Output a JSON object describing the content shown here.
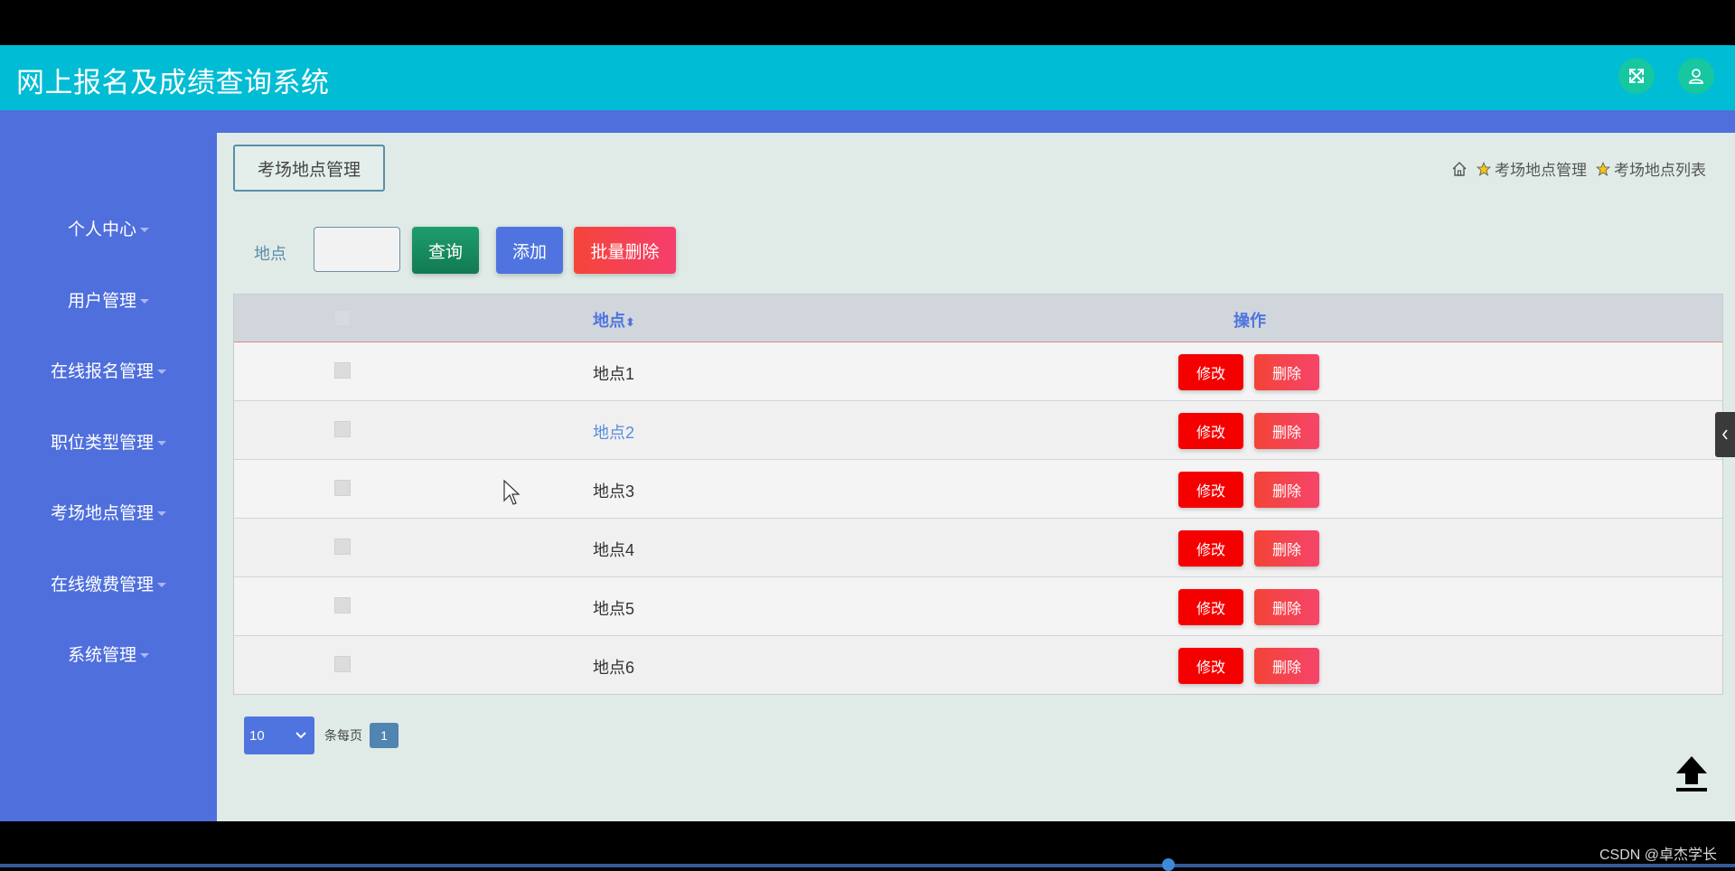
{
  "app": {
    "title": "网上报名及成绩查询系统"
  },
  "header": {
    "icons": [
      "fullscreen-icon",
      "user-icon"
    ]
  },
  "sidebar": {
    "items": [
      {
        "label": "个人中心"
      },
      {
        "label": "用户管理"
      },
      {
        "label": "在线报名管理"
      },
      {
        "label": "职位类型管理"
      },
      {
        "label": "考场地点管理"
      },
      {
        "label": "在线缴费管理"
      },
      {
        "label": "系统管理"
      }
    ]
  },
  "page": {
    "title": "考场地点管理"
  },
  "breadcrumb": {
    "item1": "考场地点管理",
    "item2": "考场地点列表"
  },
  "search": {
    "label": "地点",
    "value": "",
    "query_label": "查询",
    "add_label": "添加",
    "bulk_delete_label": "批量删除"
  },
  "table": {
    "headers": {
      "location": "地点",
      "sort_icon": "⬍",
      "operations": "操作"
    },
    "rows": [
      {
        "location": "地点1"
      },
      {
        "location": "地点2"
      },
      {
        "location": "地点3"
      },
      {
        "location": "地点4"
      },
      {
        "location": "地点5"
      },
      {
        "location": "地点6"
      }
    ],
    "edit_label": "修改",
    "delete_label": "删除"
  },
  "pagination": {
    "page_size": "10",
    "per_page_text": "条每页",
    "current_page": "1"
  },
  "watermark": "CSDN @卓杰学长",
  "colors": {
    "header": "#00bcd4",
    "sidebar": "#4f6fdd",
    "edit": "#f50000",
    "delete": "#f44336",
    "query": "#1e9e6c",
    "add": "#4f74df"
  }
}
